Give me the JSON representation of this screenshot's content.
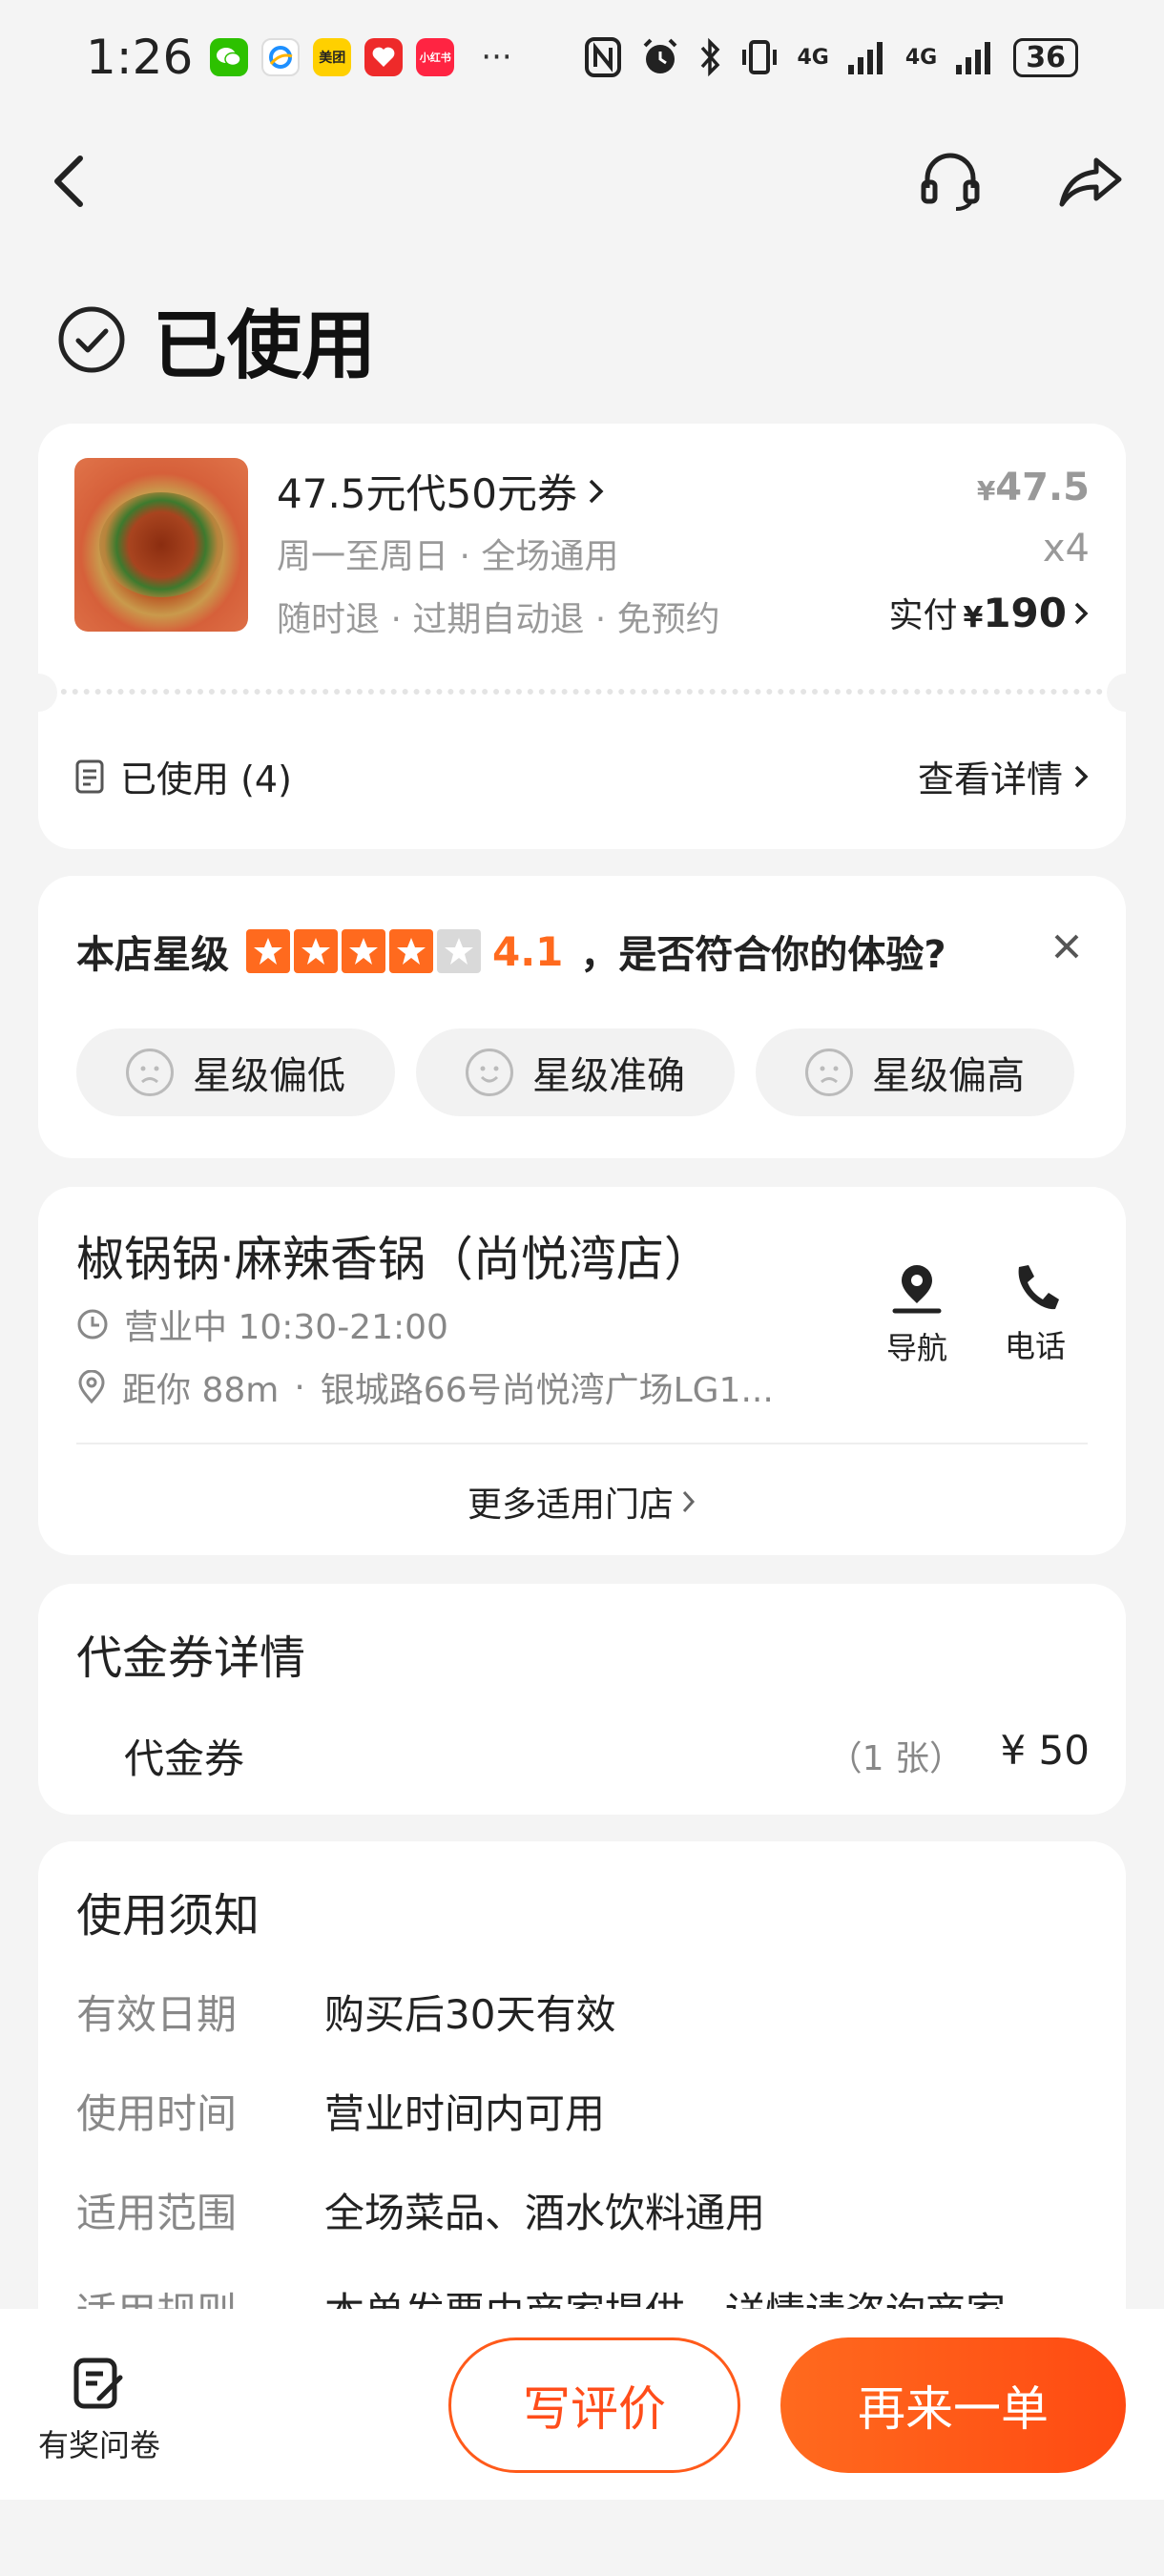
{
  "status_bar": {
    "time": "1:26",
    "apps": [
      {
        "name": "wechat-icon",
        "label": "",
        "color": "#2dc100"
      },
      {
        "name": "qq-browser-icon",
        "label": "",
        "color": "#ffffff"
      },
      {
        "name": "meituan-icon",
        "label": "美团",
        "color": "#ffd000"
      },
      {
        "name": "app-red-icon",
        "label": "",
        "color": "#ee2a2a"
      },
      {
        "name": "xiaohongshu-icon",
        "label": "小红书",
        "color": "#ff2442"
      }
    ],
    "more": "···",
    "network": "4G",
    "network2": "4G",
    "battery": "36"
  },
  "page": {
    "title": "已使用"
  },
  "order": {
    "title": "47.5元代50元券",
    "sub1": "周一至周日 · 全场通用",
    "sub2": "随时退 · 过期自动退 · 免预约",
    "price_symbol": "¥",
    "price": "47.5",
    "qty": "x4",
    "paid_label": "实付",
    "paid_symbol": "¥",
    "paid_amount": "190",
    "used_label": "已使用 (4)",
    "detail_link": "查看详情"
  },
  "rating": {
    "label": "本店星级",
    "stars_filled": 4,
    "stars_total": 5,
    "score": "4.1",
    "question": "，是否符合你的体验?",
    "chips": [
      "星级偏低",
      "星级准确",
      "星级偏高"
    ]
  },
  "shop": {
    "name": "椒锅锅·麻辣香锅（尚悦湾店）",
    "hours": "营业中 10:30-21:00",
    "distance": "距你 88m",
    "address": "银城路66号尚悦湾广场LG1...",
    "nav_label": "导航",
    "phone_label": "电话",
    "more_stores": "更多适用门店"
  },
  "voucher_detail": {
    "title": "代金券详情",
    "item": "代金券",
    "count": "（1 张）",
    "amount": "¥ 50"
  },
  "notes": {
    "title": "使用须知",
    "rows": [
      {
        "key": "有效日期",
        "value": "购买后30天有效"
      },
      {
        "key": "使用时间",
        "value": "营业时间内可用"
      },
      {
        "key": "适用范围",
        "value": "全场菜品、酒水饮料通用"
      },
      {
        "key": "适用规则",
        "value": "本单发票由商家提供，详情请咨询商家"
      }
    ]
  },
  "bottom": {
    "survey_label": "有奖问卷",
    "review_button": "写评价",
    "reorder_button": "再来一单"
  },
  "colors": {
    "accent": "#ff6a1e",
    "accent_dark": "#ff4a12"
  }
}
